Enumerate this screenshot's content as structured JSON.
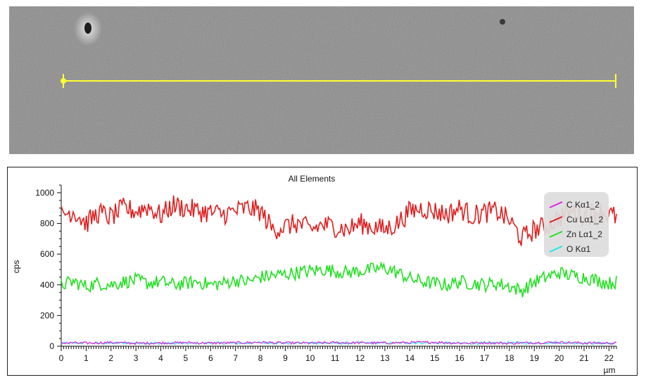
{
  "chart_data": {
    "type": "line",
    "title": "All Elements",
    "ylabel": "cps",
    "xunit": "µm",
    "xlim": [
      0,
      22.3
    ],
    "ylim": [
      0,
      1050
    ],
    "x_ticks": [
      0,
      1,
      2,
      3,
      4,
      5,
      6,
      7,
      8,
      9,
      10,
      11,
      12,
      13,
      14,
      15,
      16,
      17,
      18,
      19,
      20,
      21,
      22
    ],
    "y_ticks": [
      0,
      200,
      400,
      600,
      800,
      1000
    ],
    "grid": false,
    "legend_position": "top-right",
    "series": [
      {
        "name": "C Kα1_2",
        "color": "#e020e0",
        "x": [
          0,
          1,
          2,
          3,
          4,
          5,
          6,
          7,
          8,
          9,
          10,
          11,
          12,
          13,
          14,
          15,
          16,
          17,
          18,
          19,
          20,
          21,
          22.3
        ],
        "values": [
          22,
          20,
          24,
          19,
          21,
          23,
          20,
          22,
          25,
          21,
          20,
          23,
          22,
          21,
          24,
          26,
          20,
          22,
          19,
          23,
          25,
          21,
          20
        ]
      },
      {
        "name": "Cu Lα1_2",
        "color": "#e01e1e",
        "x": [
          0,
          0.5,
          1,
          1.5,
          2,
          2.5,
          3,
          3.5,
          4,
          4.5,
          5,
          5.5,
          6,
          6.5,
          7,
          7.5,
          8,
          8.5,
          9,
          9.5,
          10,
          10.5,
          11,
          11.5,
          12,
          12.5,
          13,
          13.5,
          14,
          14.5,
          15,
          15.5,
          16,
          16.5,
          17,
          17.5,
          18,
          18.5,
          19,
          19.5,
          20,
          20.5,
          21,
          21.5,
          22,
          22.3
        ],
        "values": [
          860,
          880,
          800,
          870,
          840,
          900,
          880,
          910,
          850,
          920,
          900,
          880,
          870,
          860,
          880,
          900,
          880,
          760,
          780,
          800,
          760,
          790,
          780,
          760,
          800,
          780,
          760,
          800,
          880,
          900,
          880,
          860,
          900,
          850,
          870,
          880,
          820,
          700,
          760,
          780,
          840,
          880,
          850,
          880,
          860,
          840
        ]
      },
      {
        "name": "Zn Lα1_2",
        "color": "#22e022",
        "x": [
          0,
          0.5,
          1,
          1.5,
          2,
          2.5,
          3,
          3.5,
          4,
          4.5,
          5,
          5.5,
          6,
          6.5,
          7,
          7.5,
          8,
          8.5,
          9,
          9.5,
          10,
          10.5,
          11,
          11.5,
          12,
          12.5,
          13,
          13.5,
          14,
          14.5,
          15,
          15.5,
          16,
          16.5,
          17,
          17.5,
          18,
          18.5,
          19,
          19.5,
          20,
          20.5,
          21,
          21.5,
          22,
          22.3
        ],
        "values": [
          400,
          420,
          390,
          410,
          400,
          420,
          430,
          410,
          420,
          400,
          410,
          420,
          400,
          410,
          430,
          420,
          450,
          460,
          470,
          480,
          490,
          500,
          490,
          480,
          490,
          500,
          510,
          480,
          440,
          420,
          410,
          400,
          420,
          410,
          400,
          410,
          390,
          360,
          420,
          450,
          480,
          460,
          450,
          430,
          410,
          420
        ]
      },
      {
        "name": "O Kα1",
        "color": "#22e6e6",
        "x": [
          0,
          1,
          2,
          3,
          4,
          5,
          6,
          7,
          8,
          9,
          10,
          11,
          12,
          13,
          14,
          15,
          16,
          17,
          18,
          19,
          20,
          21,
          22.3
        ],
        "values": [
          18,
          21,
          19,
          22,
          20,
          18,
          21,
          19,
          23,
          20,
          22,
          19,
          21,
          20,
          22,
          21,
          19,
          20,
          22,
          21,
          23,
          20,
          19
        ]
      }
    ]
  }
}
